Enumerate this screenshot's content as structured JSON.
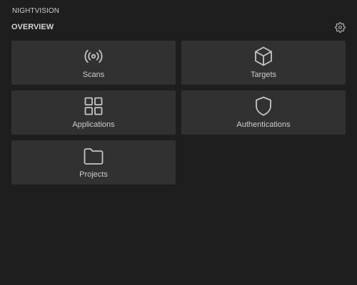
{
  "app": {
    "title": "NIGHTVISION"
  },
  "overview": {
    "title": "OVERVIEW",
    "settings_icon": "gear-icon",
    "cards": [
      {
        "label": "Scans",
        "icon": "broadcast-icon"
      },
      {
        "label": "Targets",
        "icon": "cube-icon"
      },
      {
        "label": "Applications",
        "icon": "grid-icon"
      },
      {
        "label": "Authentications",
        "icon": "shield-icon"
      },
      {
        "label": "Projects",
        "icon": "folder-icon"
      }
    ]
  },
  "colors": {
    "background": "#1e1e1e",
    "card": "#313131",
    "text": "#cccccc",
    "icon": "#c5c5c5"
  }
}
